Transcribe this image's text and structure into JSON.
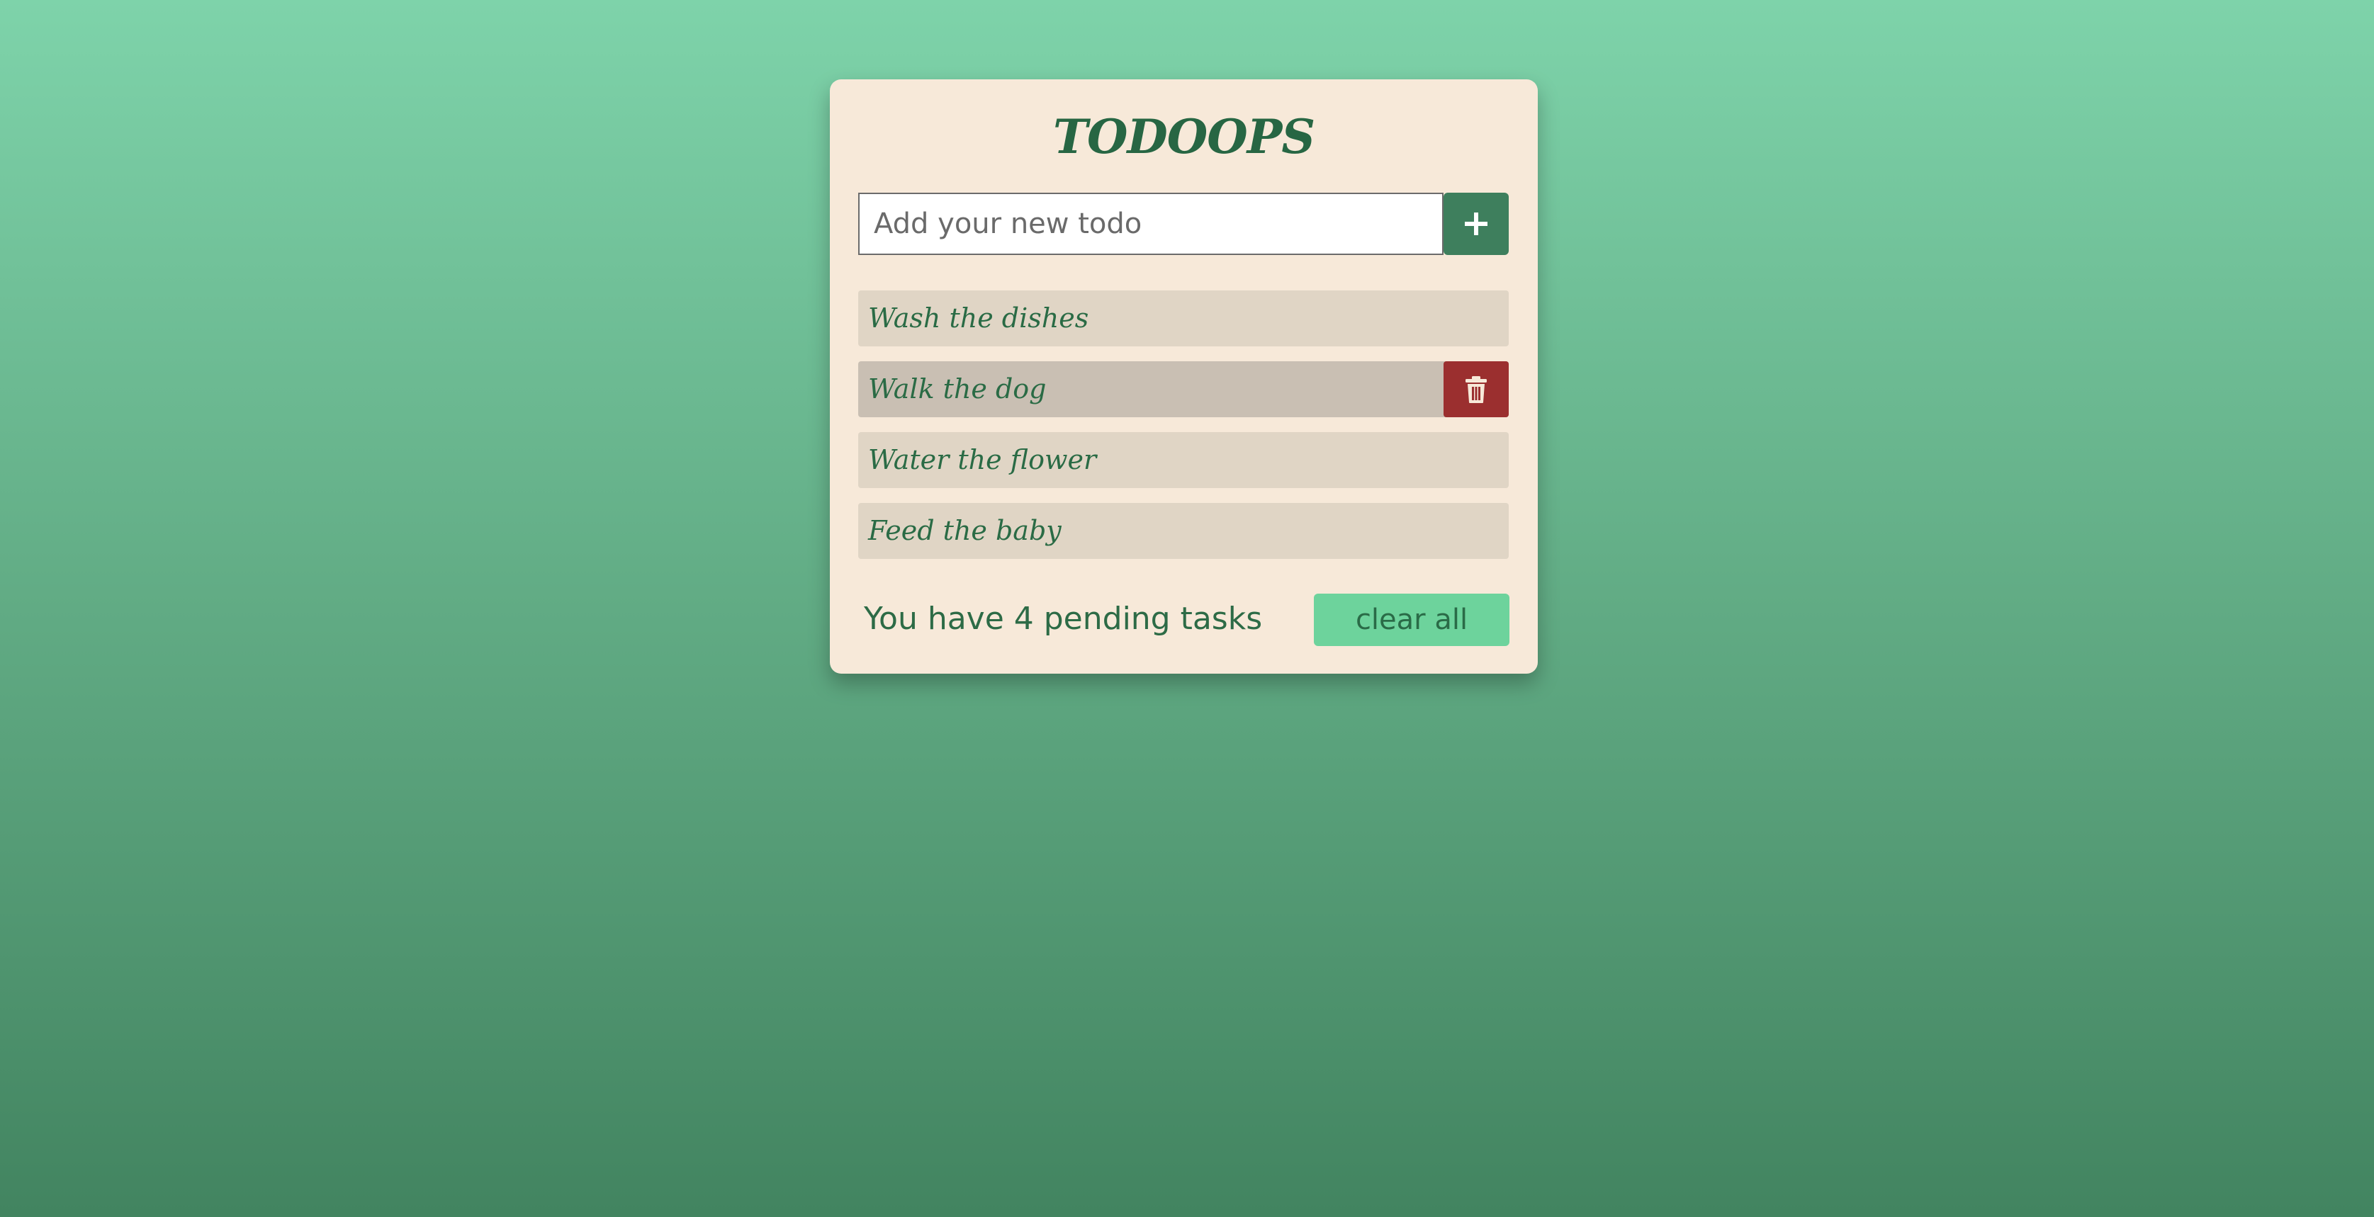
{
  "app": {
    "title": "TODOOPS"
  },
  "input": {
    "placeholder": "Add your new todo",
    "value": ""
  },
  "add_button": {
    "icon": "plus-icon"
  },
  "todos": [
    {
      "text": "Wash the dishes",
      "hovered": false
    },
    {
      "text": "Walk the dog",
      "hovered": true
    },
    {
      "text": "Water the flower",
      "hovered": false
    },
    {
      "text": "Feed the baby",
      "hovered": false
    }
  ],
  "delete_button": {
    "icon": "trash-icon"
  },
  "footer": {
    "pending_text": "You have 4 pending tasks",
    "clear_label": "clear all"
  },
  "colors": {
    "accent_green": "#3e7f5d",
    "delete_red": "#9b2f2f",
    "clear_button": "#6dd39c",
    "card_bg": "#f7e9d9",
    "text_green": "#276643"
  }
}
